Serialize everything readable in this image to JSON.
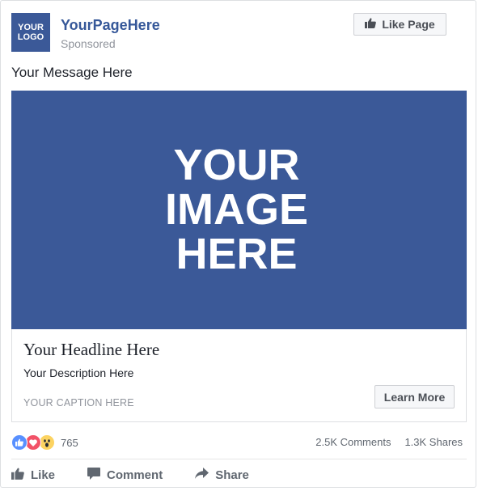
{
  "post": {
    "logo_line1": "YOUR",
    "logo_line2": "LOGO",
    "page_name": "YourPageHere",
    "sponsored": "Sponsored",
    "like_page_label": "Like Page",
    "message": "Your Message Here"
  },
  "image": {
    "line1": "YOUR",
    "line2": "IMAGE",
    "line3": "HERE",
    "background": "#3b5998"
  },
  "link": {
    "headline": "Your Headline Here",
    "description": "Your Description Here",
    "caption": "YOUR CAPTION HERE",
    "cta_label": "Learn More"
  },
  "engagement": {
    "reaction_count": "765",
    "comments": "2.5K Comments",
    "shares": "1.3K Shares",
    "reactions": [
      "like-icon",
      "love-icon",
      "wow-icon"
    ]
  },
  "actions": {
    "like": "Like",
    "comment": "Comment",
    "share": "Share"
  },
  "colors": {
    "brand": "#3b5998",
    "link": "#365899",
    "muted": "#90949c"
  }
}
